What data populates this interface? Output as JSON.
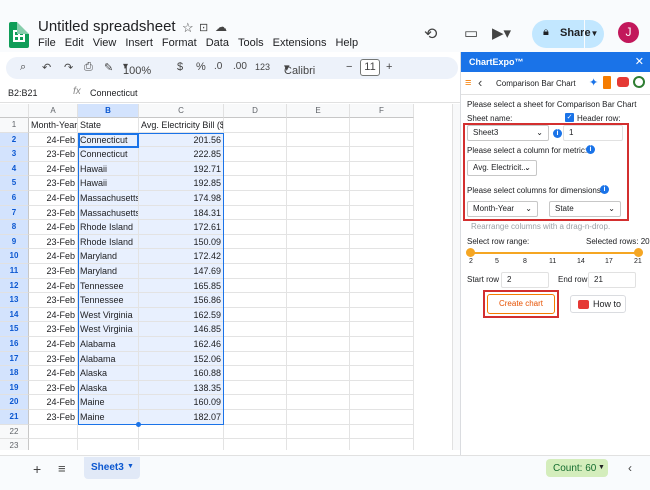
{
  "app": {
    "doc_title": "Untitled spreadsheet",
    "menus": [
      "File",
      "Edit",
      "View",
      "Insert",
      "Format",
      "Data",
      "Tools",
      "Extensions",
      "Help"
    ],
    "share_label": "Share",
    "avatar_letter": "J"
  },
  "toolbar": {
    "zoom": "100%",
    "currency": "$",
    "percent": "%",
    "dec_less": ".0",
    "dec_more": ".00",
    "num_format": "123",
    "font": "Calibri",
    "font_size": "11",
    "minus": "−",
    "plus": "+"
  },
  "formula_bar": {
    "name_box": "B2:B21",
    "fx": "fx",
    "value": "Connecticut"
  },
  "grid": {
    "columns": [
      "A",
      "B",
      "C",
      "D",
      "E",
      "F"
    ],
    "header_row": [
      "Month-Year",
      "State",
      "Avg. Electricity Bill ($)"
    ],
    "rows": [
      [
        "24-Feb",
        "Connecticut",
        "201.56"
      ],
      [
        "23-Feb",
        "Connecticut",
        "222.85"
      ],
      [
        "24-Feb",
        "Hawaii",
        "192.71"
      ],
      [
        "23-Feb",
        "Hawaii",
        "192.85"
      ],
      [
        "24-Feb",
        "Massachusetts",
        "174.98"
      ],
      [
        "23-Feb",
        "Massachusetts",
        "184.31"
      ],
      [
        "24-Feb",
        "Rhode Island",
        "172.61"
      ],
      [
        "23-Feb",
        "Rhode Island",
        "150.09"
      ],
      [
        "24-Feb",
        "Maryland",
        "172.42"
      ],
      [
        "23-Feb",
        "Maryland",
        "147.69"
      ],
      [
        "24-Feb",
        "Tennessee",
        "165.85"
      ],
      [
        "23-Feb",
        "Tennessee",
        "156.86"
      ],
      [
        "24-Feb",
        "West Virginia",
        "162.59"
      ],
      [
        "23-Feb",
        "West Virginia",
        "146.85"
      ],
      [
        "24-Feb",
        "Alabama",
        "162.46"
      ],
      [
        "23-Feb",
        "Alabama",
        "152.06"
      ],
      [
        "24-Feb",
        "Alaska",
        "160.88"
      ],
      [
        "23-Feb",
        "Alaska",
        "138.35"
      ],
      [
        "24-Feb",
        "Maine",
        "160.09"
      ],
      [
        "23-Feb",
        "Maine",
        "182.07"
      ]
    ],
    "row_numbers": [
      "1",
      "2",
      "3",
      "4",
      "5",
      "6",
      "7",
      "8",
      "9",
      "10",
      "11",
      "12",
      "13",
      "14",
      "15",
      "16",
      "17",
      "18",
      "19",
      "20",
      "21",
      "22",
      "23"
    ]
  },
  "bottom": {
    "sheet_tab": "Sheet3",
    "count": "Count: 60"
  },
  "panel": {
    "title": "ChartExpo™",
    "chart_name": "Comparison Bar Chart",
    "intro": "Please select a sheet for Comparison Bar Chart",
    "sheet_name_label": "Sheet name:",
    "header_row_label": "Header row:",
    "sheet_value": "Sheet3",
    "header_row_value": "1",
    "metric_label": "Please select a column for metric:",
    "metric_value": "Avg. Electricit...",
    "dimensions_label": "Please select columns for dimensions:",
    "dimension_1": "Month-Year",
    "dimension_2": "State",
    "rearrange_hint": "Rearrange columns with a drag-n-drop.",
    "row_range_label": "Select row range:",
    "selected_rows": "Selected rows: 20",
    "ticks": [
      "2",
      "5",
      "8",
      "11",
      "14",
      "17",
      "21"
    ],
    "start_row_label": "Start row",
    "start_row_value": "2",
    "end_row_label": "End row",
    "end_row_value": "21",
    "create_label": "Create chart",
    "howto_label": "How to"
  },
  "colors": {
    "accent": "#1a73e8",
    "selection": "#e8f0fe",
    "highlight_red": "#d32f2f",
    "slider": "#f5a623"
  }
}
